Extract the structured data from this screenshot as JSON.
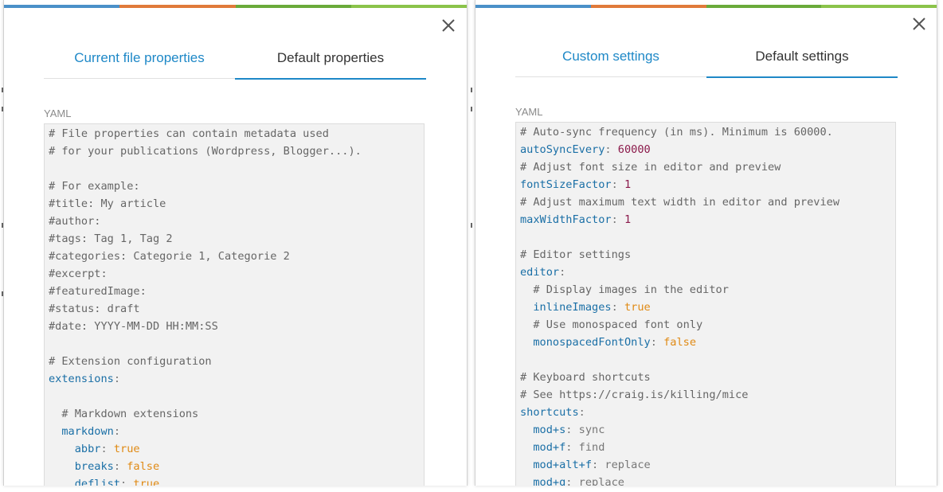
{
  "colors": {
    "accent": "#1e88c7",
    "top_stripe": [
      "#4a90c8",
      "#e07a3a",
      "#6aaa3a",
      "#8bc34a"
    ]
  },
  "left_panel": {
    "close_icon": "close-icon",
    "tabs": [
      {
        "label": "Current file properties",
        "active": false
      },
      {
        "label": "Default properties",
        "active": true
      }
    ],
    "section_label": "YAML",
    "code_lines": [
      [
        {
          "t": "c",
          "v": "# File properties can contain metadata used"
        }
      ],
      [
        {
          "t": "c",
          "v": "# for your publications (Wordpress, Blogger...)."
        }
      ],
      [],
      [
        {
          "t": "c",
          "v": "# For example:"
        }
      ],
      [
        {
          "t": "c",
          "v": "#title: My article"
        }
      ],
      [
        {
          "t": "c",
          "v": "#author:"
        }
      ],
      [
        {
          "t": "c",
          "v": "#tags: Tag 1, Tag 2"
        }
      ],
      [
        {
          "t": "c",
          "v": "#categories: Categorie 1, Categorie 2"
        }
      ],
      [
        {
          "t": "c",
          "v": "#excerpt:"
        }
      ],
      [
        {
          "t": "c",
          "v": "#featuredImage:"
        }
      ],
      [
        {
          "t": "c",
          "v": "#status: draft"
        }
      ],
      [
        {
          "t": "c",
          "v": "#date: YYYY-MM-DD HH:MM:SS"
        }
      ],
      [],
      [
        {
          "t": "c",
          "v": "# Extension configuration"
        }
      ],
      [
        {
          "t": "k",
          "v": "extensions"
        },
        {
          "t": "p",
          "v": ":"
        }
      ],
      [],
      [
        {
          "t": "s",
          "v": "  "
        },
        {
          "t": "c",
          "v": "# Markdown extensions"
        }
      ],
      [
        {
          "t": "s",
          "v": "  "
        },
        {
          "t": "k",
          "v": "markdown"
        },
        {
          "t": "p",
          "v": ":"
        }
      ],
      [
        {
          "t": "s",
          "v": "    "
        },
        {
          "t": "k",
          "v": "abbr"
        },
        {
          "t": "p",
          "v": ": "
        },
        {
          "t": "b",
          "v": "true"
        }
      ],
      [
        {
          "t": "s",
          "v": "    "
        },
        {
          "t": "k",
          "v": "breaks"
        },
        {
          "t": "p",
          "v": ": "
        },
        {
          "t": "b",
          "v": "false"
        }
      ],
      [
        {
          "t": "s",
          "v": "    "
        },
        {
          "t": "k",
          "v": "deflist"
        },
        {
          "t": "p",
          "v": ": "
        },
        {
          "t": "b",
          "v": "true"
        }
      ]
    ]
  },
  "right_panel": {
    "close_icon": "close-icon",
    "tabs": [
      {
        "label": "Custom settings",
        "active": false
      },
      {
        "label": "Default settings",
        "active": true
      }
    ],
    "section_label": "YAML",
    "code_lines": [
      [
        {
          "t": "c",
          "v": "# Auto-sync frequency (in ms). Minimum is 60000."
        }
      ],
      [
        {
          "t": "k",
          "v": "autoSyncEvery"
        },
        {
          "t": "p",
          "v": ": "
        },
        {
          "t": "n",
          "v": "60000"
        }
      ],
      [
        {
          "t": "c",
          "v": "# Adjust font size in editor and preview"
        }
      ],
      [
        {
          "t": "k",
          "v": "fontSizeFactor"
        },
        {
          "t": "p",
          "v": ": "
        },
        {
          "t": "n",
          "v": "1"
        }
      ],
      [
        {
          "t": "c",
          "v": "# Adjust maximum text width in editor and preview"
        }
      ],
      [
        {
          "t": "k",
          "v": "maxWidthFactor"
        },
        {
          "t": "p",
          "v": ": "
        },
        {
          "t": "n",
          "v": "1"
        }
      ],
      [],
      [
        {
          "t": "c",
          "v": "# Editor settings"
        }
      ],
      [
        {
          "t": "k",
          "v": "editor"
        },
        {
          "t": "p",
          "v": ":"
        }
      ],
      [
        {
          "t": "s",
          "v": "  "
        },
        {
          "t": "c",
          "v": "# Display images in the editor"
        }
      ],
      [
        {
          "t": "s",
          "v": "  "
        },
        {
          "t": "k",
          "v": "inlineImages"
        },
        {
          "t": "p",
          "v": ": "
        },
        {
          "t": "b",
          "v": "true"
        }
      ],
      [
        {
          "t": "s",
          "v": "  "
        },
        {
          "t": "c",
          "v": "# Use monospaced font only"
        }
      ],
      [
        {
          "t": "s",
          "v": "  "
        },
        {
          "t": "k",
          "v": "monospacedFontOnly"
        },
        {
          "t": "p",
          "v": ": "
        },
        {
          "t": "b",
          "v": "false"
        }
      ],
      [],
      [
        {
          "t": "c",
          "v": "# Keyboard shortcuts"
        }
      ],
      [
        {
          "t": "c",
          "v": "# See https://craig.is/killing/mice"
        }
      ],
      [
        {
          "t": "k",
          "v": "shortcuts"
        },
        {
          "t": "p",
          "v": ":"
        }
      ],
      [
        {
          "t": "s",
          "v": "  "
        },
        {
          "t": "k",
          "v": "mod+s"
        },
        {
          "t": "p",
          "v": ": sync"
        }
      ],
      [
        {
          "t": "s",
          "v": "  "
        },
        {
          "t": "k",
          "v": "mod+f"
        },
        {
          "t": "p",
          "v": ": find"
        }
      ],
      [
        {
          "t": "s",
          "v": "  "
        },
        {
          "t": "k",
          "v": "mod+alt+f"
        },
        {
          "t": "p",
          "v": ": replace"
        }
      ],
      [
        {
          "t": "s",
          "v": "  "
        },
        {
          "t": "k",
          "v": "mod+g"
        },
        {
          "t": "p",
          "v": ": replace"
        }
      ]
    ]
  }
}
